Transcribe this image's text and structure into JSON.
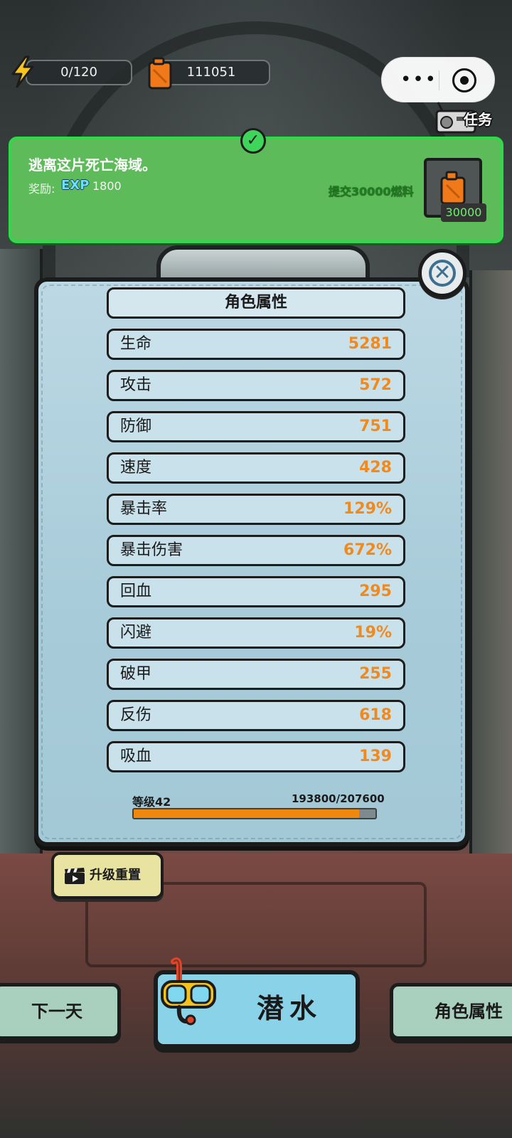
{
  "hud": {
    "energy": "0/120",
    "fuel": "111051",
    "more_menu": "•••",
    "task_label": "任务"
  },
  "quest": {
    "title": "逃离这片死亡海域。",
    "reward_label": "奖励:",
    "reward_type": "EXP",
    "reward_value": "1800",
    "submit_text": "提交30000燃料",
    "item_qty": "30000",
    "check_mark": "✓"
  },
  "panel": {
    "title": "角色属性",
    "close_icon": "✕",
    "stats": [
      {
        "name": "生命",
        "value": "5281"
      },
      {
        "name": "攻击",
        "value": "572"
      },
      {
        "name": "防御",
        "value": "751"
      },
      {
        "name": "速度",
        "value": "428"
      },
      {
        "name": "暴击率",
        "value": "129%"
      },
      {
        "name": "暴击伤害",
        "value": "672%"
      },
      {
        "name": "回血",
        "value": "295"
      },
      {
        "name": "闪避",
        "value": "19%"
      },
      {
        "name": "破甲",
        "value": "255"
      },
      {
        "name": "反伤",
        "value": "618"
      },
      {
        "name": "吸血",
        "value": "139"
      }
    ],
    "level_label": "等级42",
    "xp_text": "193800/207600",
    "xp_current": 193800,
    "xp_max": 207600
  },
  "buttons": {
    "reset": "升级重置",
    "next_day": "下一天",
    "dive": "潜水",
    "attributes": "角色属性"
  },
  "colors": {
    "quest_bg": "#5dbb59",
    "stat_value": "#f08a1e",
    "xp_fill": "#f0880e",
    "panel_bg": "#bcd8e4"
  }
}
